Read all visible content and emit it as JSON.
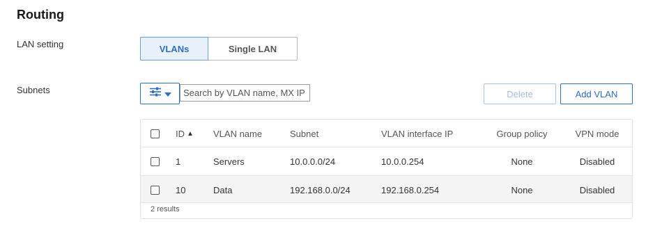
{
  "page": {
    "title": "Routing"
  },
  "lan_setting": {
    "label": "LAN setting",
    "options": [
      "VLANs",
      "Single LAN"
    ],
    "selected": "VLANs"
  },
  "subnets": {
    "label": "Subnets",
    "filter_icon": "sliders-icon",
    "search_placeholder": "Search by VLAN name, MX IP",
    "delete_label": "Delete",
    "add_label": "Add VLAN",
    "table": {
      "columns": [
        "ID",
        "VLAN name",
        "Subnet",
        "VLAN interface IP",
        "Group policy",
        "VPN mode"
      ],
      "sort_indicator": "▲",
      "rows": [
        {
          "id": "1",
          "name": "Servers",
          "subnet": "10.0.0.0/24",
          "interface_ip": "10.0.0.254",
          "group_policy": "None",
          "vpn_mode": "Disabled"
        },
        {
          "id": "10",
          "name": "Data",
          "subnet": "192.168.0.0/24",
          "interface_ip": "192.168.0.254",
          "group_policy": "None",
          "vpn_mode": "Disabled"
        }
      ],
      "footer": "2 results"
    }
  },
  "colors": {
    "accent": "#2f6dbf",
    "segment_active_bg": "#e8f1fb",
    "row_alt_bg": "#f4f4f4"
  }
}
